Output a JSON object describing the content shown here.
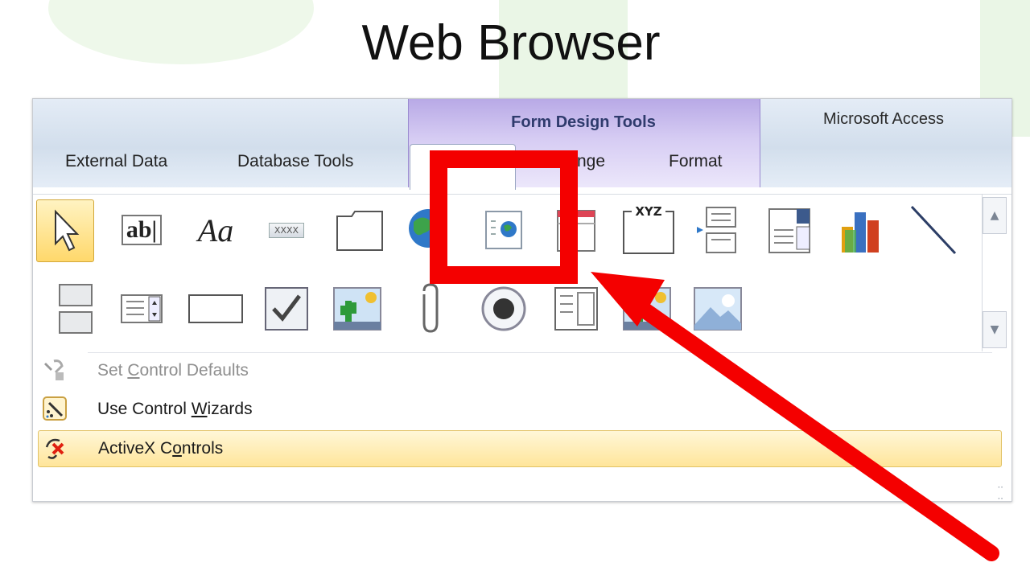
{
  "heading": "Web Browser",
  "ribbon": {
    "context_group_title": "Form Design Tools",
    "app_title": "Microsoft Access",
    "tabs": [
      "External Data",
      "Database Tools",
      "",
      "nge",
      "Format"
    ]
  },
  "controls": [
    {
      "icon": "select-pointer-icon"
    },
    {
      "icon": "textbox-icon",
      "text": "ab|"
    },
    {
      "icon": "label-icon",
      "text": "Aa"
    },
    {
      "icon": "button-icon",
      "text": "XXXX"
    },
    {
      "icon": "tab-control-icon"
    },
    {
      "icon": "hyperlink-globe-icon"
    },
    {
      "icon": "web-browser-control-icon"
    },
    {
      "icon": "navigation-control-icon"
    },
    {
      "icon": "option-group-icon",
      "text": "XYZ"
    },
    {
      "icon": "page-break-icon"
    },
    {
      "icon": "combo-box-icon"
    },
    {
      "icon": "chart-icon"
    },
    {
      "icon": "line-icon"
    },
    {
      "icon": "toggle-button-icon"
    },
    {
      "icon": "list-box-icon"
    },
    {
      "icon": "rectangle-icon"
    },
    {
      "icon": "check-box-icon"
    },
    {
      "icon": "unbound-object-frame-icon"
    },
    {
      "icon": "attachment-icon"
    },
    {
      "icon": "option-button-icon"
    },
    {
      "icon": "subform-icon"
    },
    {
      "icon": "bound-object-frame-icon"
    },
    {
      "icon": "image-icon"
    }
  ],
  "menu": {
    "set_defaults": {
      "pre": "Set ",
      "ul": "C",
      "post": "ontrol Defaults"
    },
    "wizards": {
      "pre": "Use Control ",
      "ul": "W",
      "post": "izards"
    },
    "activex": {
      "pre": "ActiveX C",
      "ul": "o",
      "post": "ntrols"
    }
  },
  "colors": {
    "highlight": "#f40000",
    "context_tab": "#c8bcf0",
    "selection": "#ffd86b"
  }
}
